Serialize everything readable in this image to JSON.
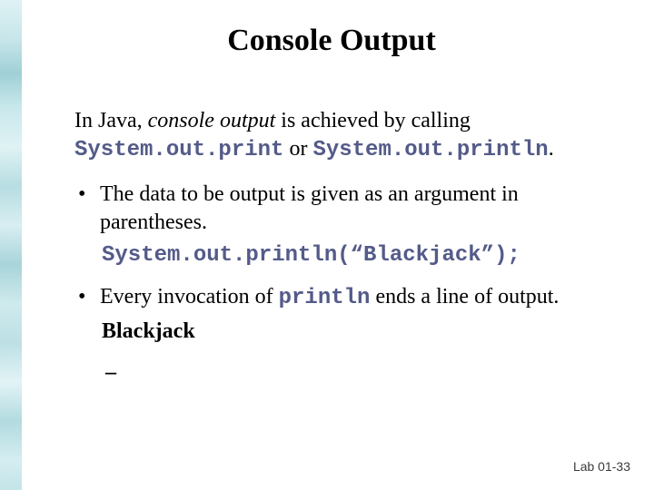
{
  "title": "Console Output",
  "intro": {
    "lead": "In Java, ",
    "italic": "console output",
    "tail": " is achieved by calling",
    "code1": "System.out.print",
    "or": " or ",
    "code2": "System.out.println",
    "period": "."
  },
  "bullets": [
    {
      "text": "The data to be output is given as an argument in parentheses.",
      "code": "System.out.println(“Blackjack”);"
    },
    {
      "pre": "Every invocation of ",
      "code_inline": "println",
      "post": " ends a line of output.",
      "output": "Blackjack",
      "cursor": "_"
    }
  ],
  "footer": "Lab 01-33"
}
